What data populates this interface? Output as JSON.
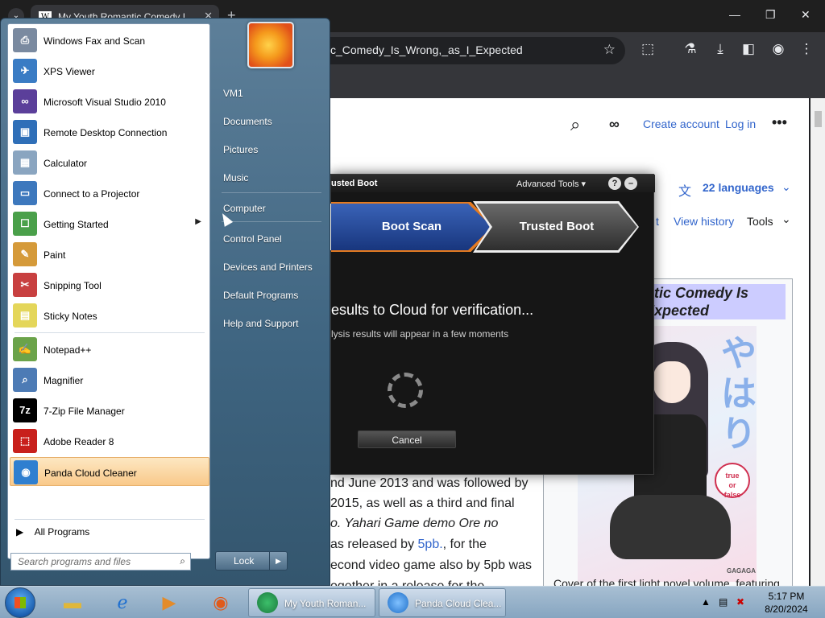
{
  "browser": {
    "tab_title": "My Youth Romantic Comedy I",
    "tab_favicon": "W",
    "url_visible": "c_Comedy_Is_Wrong,_as_I_Expected"
  },
  "wiki": {
    "create_account": "Create account",
    "log_in": "Log in",
    "languages": "22 languages",
    "tab_partial": "t",
    "view_history": "View history",
    "tools": "Tools",
    "infobox_title": "mantic Comedy Is\ns I Expected",
    "infobox_title_line1": "mantic Comedy Is",
    "infobox_title_line2": "s I Expected",
    "cover_badge": "true or false",
    "cover_badge_line1": "true",
    "cover_badge_line2": "or",
    "cover_badge_line3": "false",
    "cover_publisher": "GAGAGA",
    "caption": "Cover of the first light novel volume, featuring",
    "body_lines": [
      "nd June 2013 and was followed by",
      "2015, as well as a third and final",
      "Yahari Game demo Ore no",
      "as released by",
      "econd video game also by 5pb was",
      "ogether in a release for the"
    ],
    "body_line3_prefix": "o.",
    "link_5pb": "5pb.",
    "body_line4_suffix": ", for the"
  },
  "panda": {
    "title": "usted Boot",
    "advanced_tools": "Advanced Tools",
    "help": "?",
    "step_boot_scan": "Boot Scan",
    "step_trusted_boot": "Trusted Boot",
    "message": "esults to Cloud for verification...",
    "sub_message": "lysis results will appear in a few moments",
    "cancel": "Cancel"
  },
  "startmenu": {
    "programs": [
      {
        "label": "Windows Fax and Scan",
        "icon": "fax-icon",
        "color": "#7a8aa0"
      },
      {
        "label": "XPS Viewer",
        "icon": "xps-icon",
        "color": "#3a7cc4"
      },
      {
        "label": "Microsoft Visual Studio 2010",
        "icon": "visual-studio-icon",
        "color": "#5b3f9a"
      },
      {
        "label": "Remote Desktop Connection",
        "icon": "remote-desktop-icon",
        "color": "#2f6fb8"
      },
      {
        "label": "Calculator",
        "icon": "calculator-icon",
        "color": "#8aa5c0"
      },
      {
        "label": "Connect to a Projector",
        "icon": "projector-icon",
        "color": "#3d78bd"
      },
      {
        "label": "Getting Started",
        "icon": "getting-started-icon",
        "color": "#4aa04a"
      },
      {
        "label": "Paint",
        "icon": "paint-icon",
        "color": "#d59a3a"
      },
      {
        "label": "Snipping Tool",
        "icon": "scissors-icon",
        "color": "#c84040"
      },
      {
        "label": "Sticky Notes",
        "icon": "sticky-notes-icon",
        "color": "#e4d65a"
      },
      {
        "label": "Notepad++",
        "icon": "notepad-plus-plus-icon",
        "color": "#6ba34a"
      },
      {
        "label": "Magnifier",
        "icon": "magnifier-icon",
        "color": "#4d7bb5"
      },
      {
        "label": "7-Zip File Manager",
        "icon": "seven-zip-icon",
        "color": "#000000"
      },
      {
        "label": "Adobe Reader 8",
        "icon": "adobe-reader-icon",
        "color": "#c8201c"
      },
      {
        "label": "Panda Cloud Cleaner",
        "icon": "panda-icon",
        "color": "#2f7fd0"
      }
    ],
    "icon_glyphs": [
      "⎙",
      "✈",
      "∞",
      "▣",
      "▦",
      "▭",
      "☐",
      "✎",
      "✂",
      "▤",
      "✍",
      "⌕",
      "7z",
      "⬚",
      "◉"
    ],
    "all_programs": "All Programs",
    "search_placeholder": "Search programs and files",
    "right_items": [
      "VM1",
      "Documents",
      "Pictures",
      "Music",
      "Computer",
      "Control Panel",
      "Devices and Printers",
      "Default Programs",
      "Help and Support"
    ],
    "lock": "Lock"
  },
  "taskbar": {
    "task1": "My Youth Roman...",
    "task2": "Panda Cloud Clea...",
    "time": "5:17 PM",
    "date": "8/20/2024"
  }
}
